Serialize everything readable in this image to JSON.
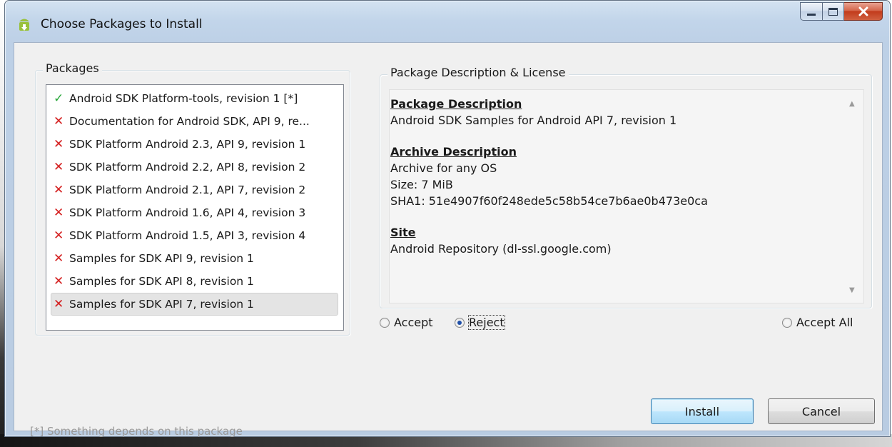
{
  "window": {
    "title": "Choose Packages to Install"
  },
  "packages": {
    "legend": "Packages",
    "items": [
      {
        "status": "accepted",
        "symbol": "✓",
        "label": "Android SDK Platform-tools, revision 1 [*]"
      },
      {
        "status": "rejected",
        "symbol": "✕",
        "label": "Documentation for Android SDK, API 9, re..."
      },
      {
        "status": "rejected",
        "symbol": "✕",
        "label": "SDK Platform Android 2.3, API 9, revision 1"
      },
      {
        "status": "rejected",
        "symbol": "✕",
        "label": "SDK Platform Android 2.2, API 8, revision 2"
      },
      {
        "status": "rejected",
        "symbol": "✕",
        "label": "SDK Platform Android 2.1, API 7, revision 2"
      },
      {
        "status": "rejected",
        "symbol": "✕",
        "label": "SDK Platform Android 1.6, API 4, revision 3"
      },
      {
        "status": "rejected",
        "symbol": "✕",
        "label": "SDK Platform Android 1.5, API 3, revision 4"
      },
      {
        "status": "rejected",
        "symbol": "✕",
        "label": "Samples for SDK API 9, revision 1"
      },
      {
        "status": "rejected",
        "symbol": "✕",
        "label": "Samples for SDK API 8, revision 1"
      },
      {
        "status": "rejected",
        "symbol": "✕",
        "label": "Samples for SDK API 7, revision 1",
        "selected": true
      }
    ]
  },
  "description": {
    "legend": "Package Description & License",
    "package_heading": "Package Description",
    "package_text": "Android SDK Samples for Android API 7, revision 1",
    "archive_heading": "Archive Description",
    "archive_os": "Archive for any OS",
    "archive_size": "Size: 7 MiB",
    "archive_sha1": "SHA1: 51e4907f60f248ede5c58b54ce7b6ae0b473e0ca",
    "site_heading": "Site",
    "site_text": "Android Repository (dl-ssl.google.com)"
  },
  "choice": {
    "accept_label": "Accept",
    "reject_label": "Reject",
    "accept_all_label": "Accept All",
    "selected": "reject"
  },
  "footer": {
    "footnote": "[*] Something depends on this package",
    "install_label": "Install",
    "cancel_label": "Cancel"
  },
  "colors": {
    "accepted": "#2aa83b",
    "rejected": "#d42020"
  }
}
